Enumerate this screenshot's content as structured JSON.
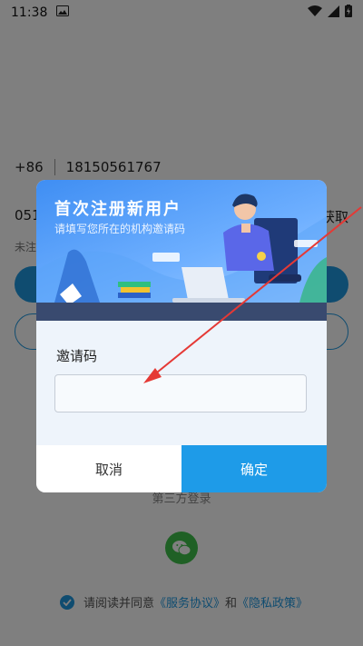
{
  "status_bar": {
    "time": "11:38",
    "icons": [
      "gallery-icon",
      "wifi-icon",
      "signal-icon",
      "battery-charging-icon"
    ]
  },
  "background": {
    "country_code": "+86",
    "phone_number": "18150561767",
    "code_prefix": "051",
    "get_code_label": "获取",
    "hint_prefix": "未注",
    "third_party_label": "第三方登录",
    "agreement": {
      "prefix": "请阅读并同意",
      "service_link": "《服务协议》",
      "and": "和",
      "privacy_link": "《隐私政策》"
    }
  },
  "dialog": {
    "title": "首次注册新用户",
    "subtitle": "请填写您所在的机构邀请码",
    "field_label": "邀请码",
    "input_value": "",
    "input_placeholder": "",
    "cancel_label": "取消",
    "confirm_label": "确定"
  },
  "colors": {
    "accent": "#1e9be8",
    "wechat_green": "#3ec14a",
    "annotation": "#e53935"
  }
}
